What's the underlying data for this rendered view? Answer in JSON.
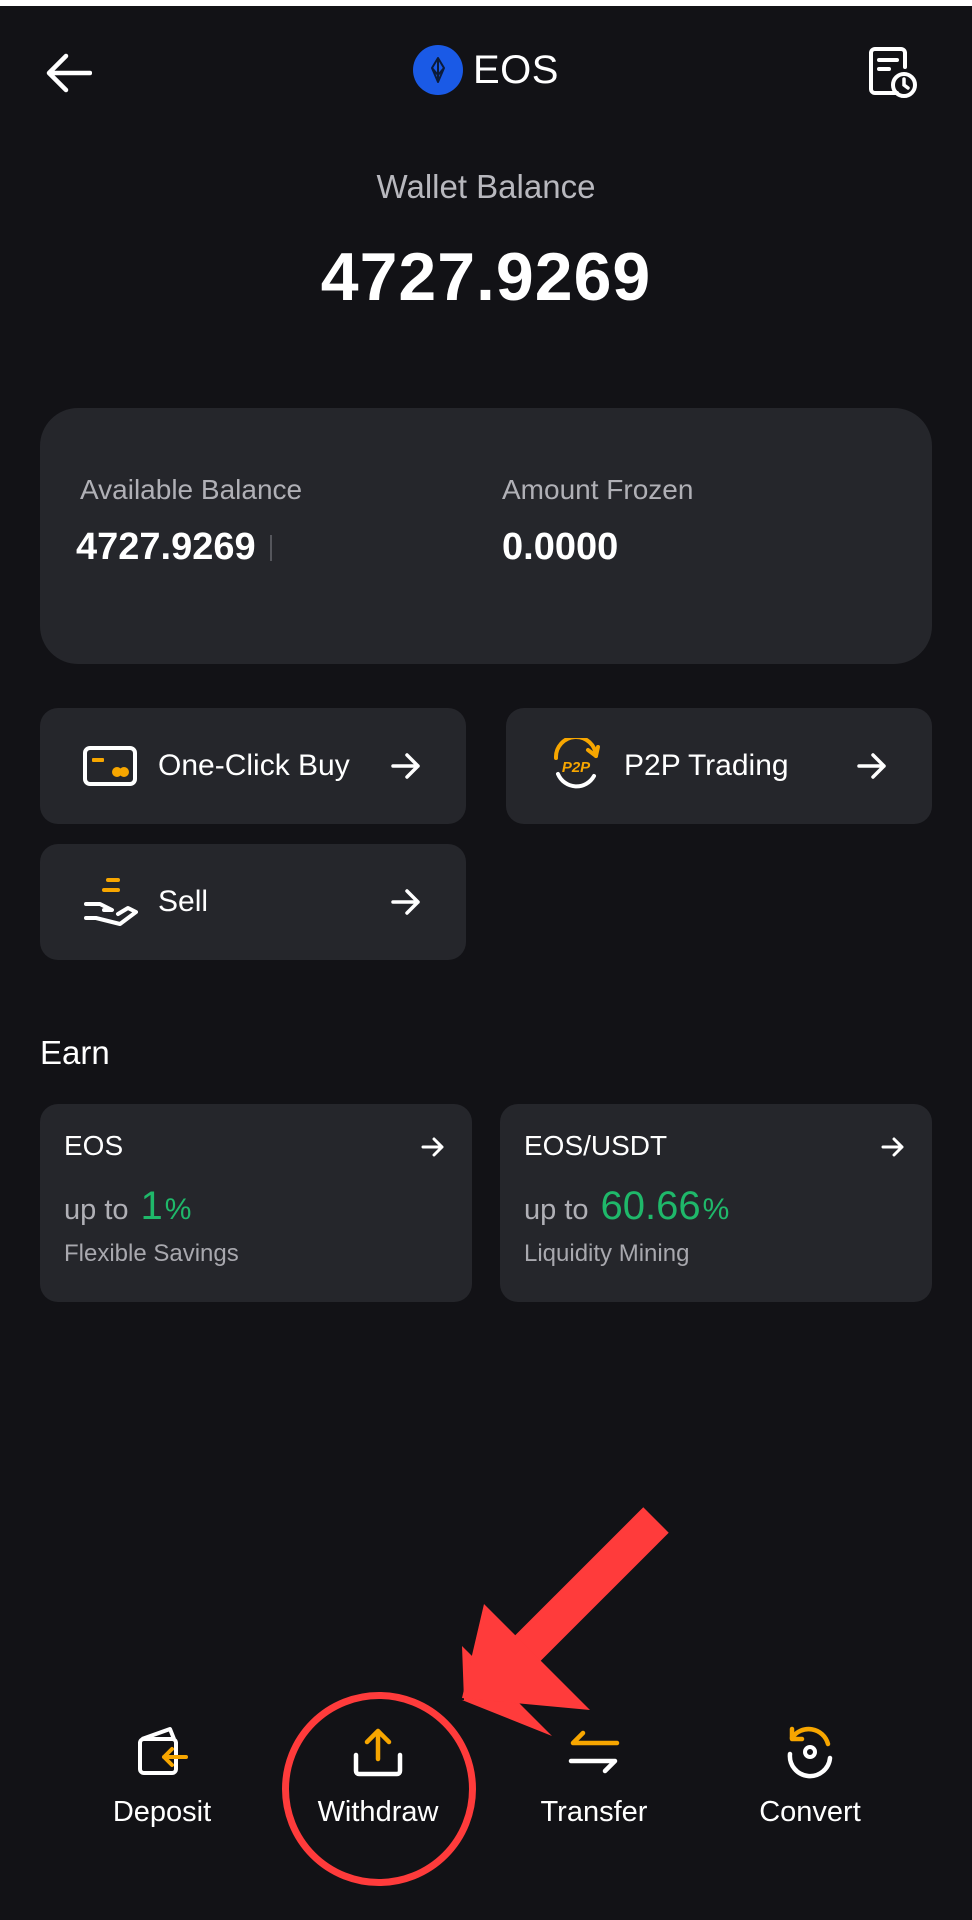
{
  "header": {
    "title": "EOS",
    "back_icon": "arrow-left-icon",
    "coin_icon": "eos-logo-icon",
    "history_icon": "document-clock-icon"
  },
  "wallet": {
    "label": "Wallet Balance",
    "value": "4727.9269"
  },
  "balances": {
    "available_label": "Available Balance",
    "available_value": "4727.9269",
    "frozen_label": "Amount Frozen",
    "frozen_value": "0.0000"
  },
  "actions": {
    "one_click_buy": "One-Click Buy",
    "p2p_trading": "P2P Trading",
    "p2p_badge": "P2P",
    "sell": "Sell"
  },
  "earn": {
    "title": "Earn",
    "cards": [
      {
        "name": "EOS",
        "prefix": "up to",
        "rate": "1",
        "unit": "%",
        "sub": "Flexible Savings"
      },
      {
        "name": "EOS/USDT",
        "prefix": "up to",
        "rate": "60.66",
        "unit": "%",
        "sub": "Liquidity Mining"
      }
    ]
  },
  "bottom_nav": [
    {
      "label": "Deposit",
      "icon": "deposit-icon"
    },
    {
      "label": "Withdraw",
      "icon": "withdraw-upload-icon"
    },
    {
      "label": "Transfer",
      "icon": "transfer-arrows-icon"
    },
    {
      "label": "Convert",
      "icon": "convert-icon"
    }
  ],
  "colors": {
    "background": "#121216",
    "card": "#25262b",
    "accent_orange": "#f7a600",
    "positive_green": "#1fb86a",
    "annotation_red": "#ff3b3b"
  }
}
